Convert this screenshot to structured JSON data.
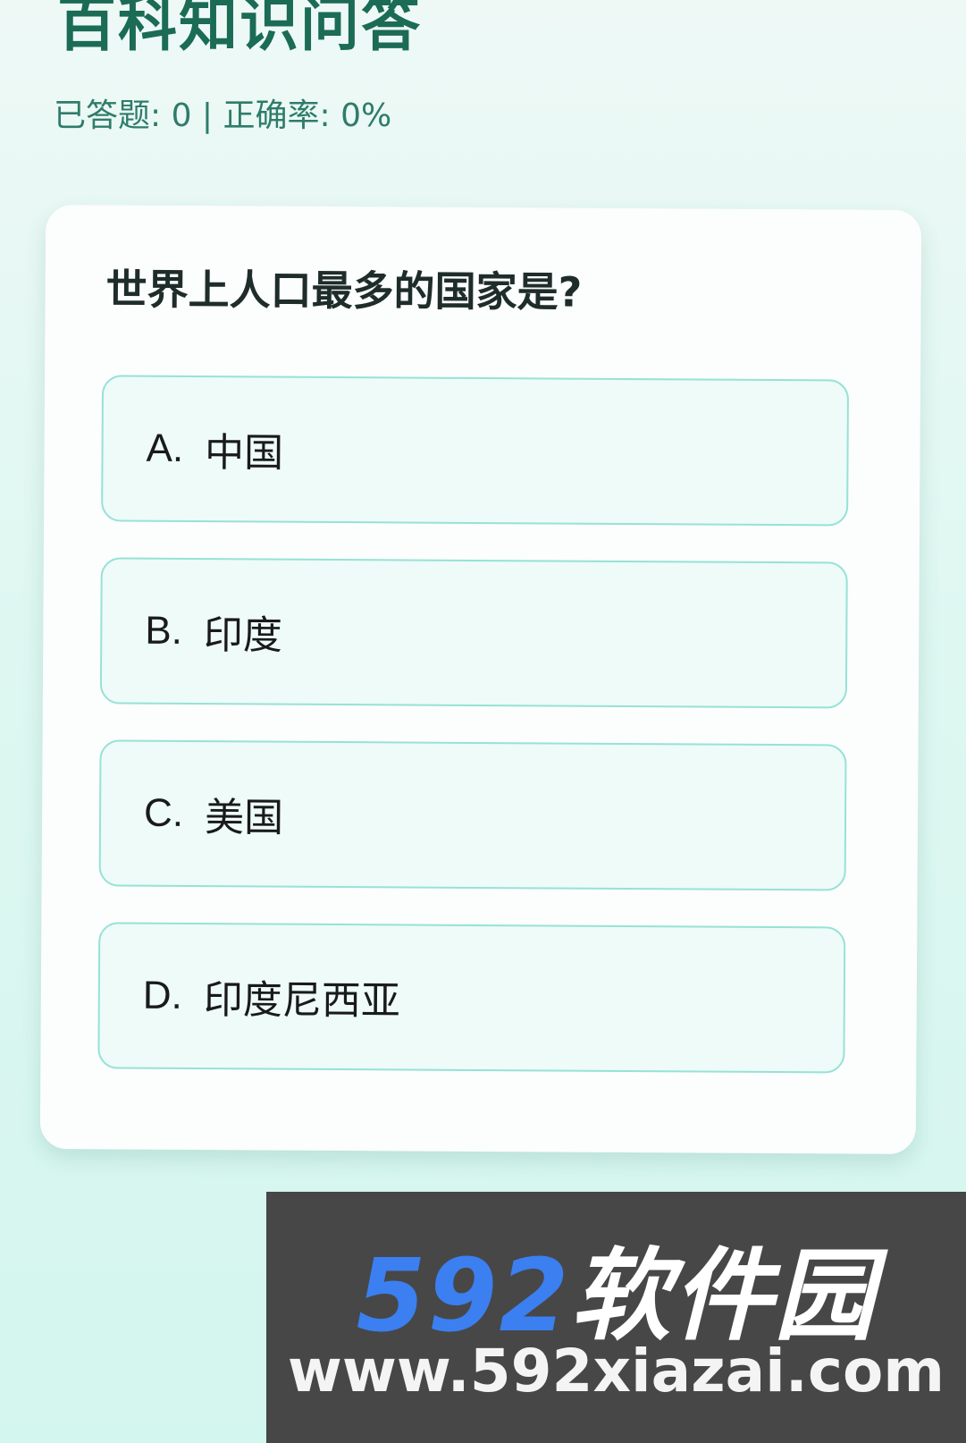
{
  "header": {
    "title": "百科知识问答",
    "stats": "已答题: 0 | 正确率: 0%"
  },
  "quiz": {
    "question": "世界上人口最多的国家是?",
    "options": [
      {
        "letter": "A.",
        "text": "中国"
      },
      {
        "letter": "B.",
        "text": "印度"
      },
      {
        "letter": "C.",
        "text": "美国"
      },
      {
        "letter": "D.",
        "text": "印度尼西亚"
      }
    ]
  },
  "watermark": {
    "logo_number": "592",
    "logo_text": "软件园",
    "url": "www.592xiazai.com"
  },
  "colors": {
    "title": "#1b6b55",
    "option_border": "#96e2d6",
    "option_bg": "#eefbf8",
    "watermark_bg": "#474747",
    "watermark_logo": "#3b7ff0"
  }
}
